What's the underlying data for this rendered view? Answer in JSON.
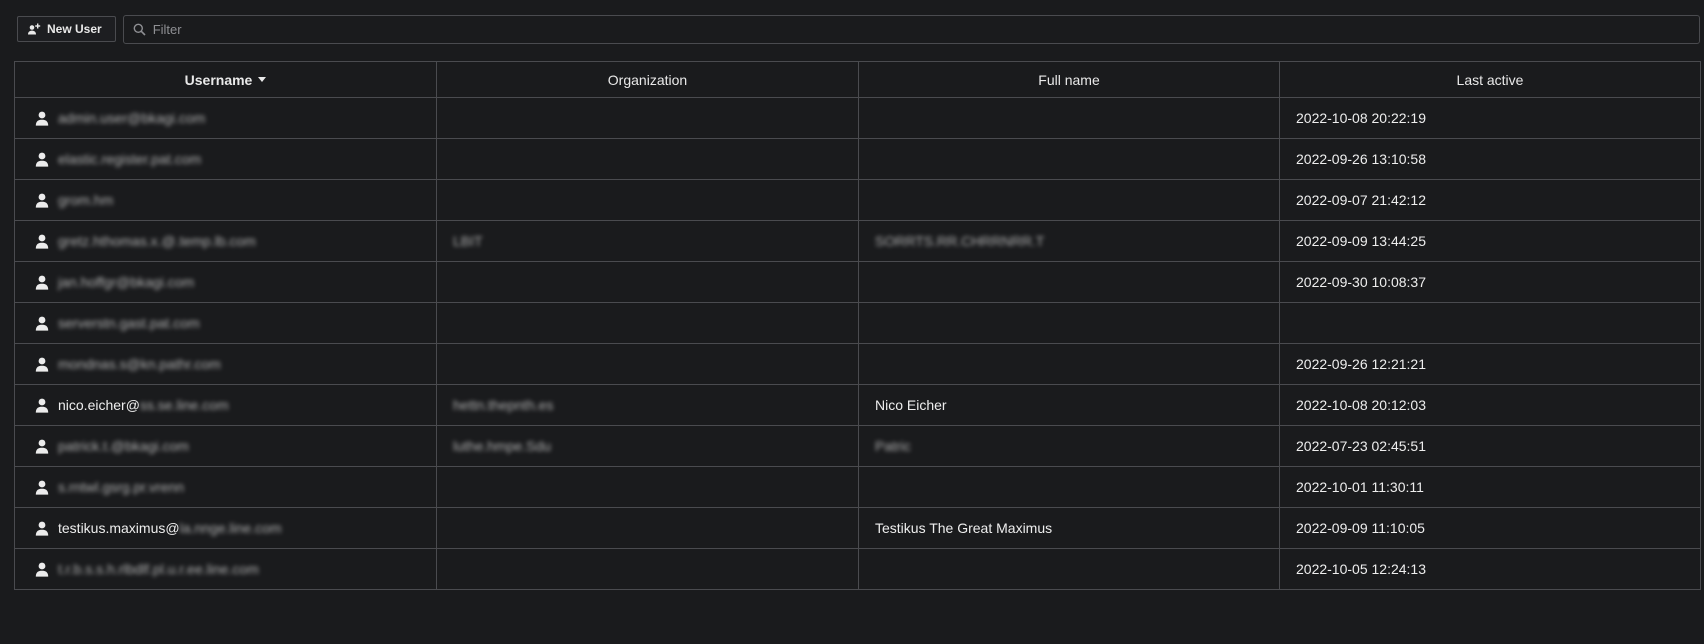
{
  "toolbar": {
    "new_user_label": "New User",
    "filter_placeholder": "Filter"
  },
  "table": {
    "columns": [
      "Username",
      "Organization",
      "Full name",
      "Last active"
    ],
    "sorted_column": "Username",
    "sort_direction": "descending",
    "rows": [
      {
        "username": "",
        "username_visible": "",
        "username_redacted": "admin.user@bkagi.com",
        "organization": "",
        "organization_redacted": "",
        "full_name": "",
        "full_name_redacted": "",
        "last_active": "2022-10-08 20:22:19"
      },
      {
        "username": "",
        "username_visible": "",
        "username_redacted": "elastic.register.pat.com",
        "organization": "",
        "organization_redacted": "",
        "full_name": "",
        "full_name_redacted": "",
        "last_active": "2022-09-26 13:10:58"
      },
      {
        "username": "",
        "username_visible": "",
        "username_redacted": "grom.hm",
        "organization": "",
        "organization_redacted": "",
        "full_name": "",
        "full_name_redacted": "",
        "last_active": "2022-09-07 21:42:12"
      },
      {
        "username": "",
        "username_visible": "",
        "username_redacted": "gretz.hthomas.x.@.temp.lb.com",
        "organization": "",
        "organization_redacted": "LBIT",
        "full_name": "",
        "full_name_redacted": "SORRTS.RR.CHRRNRR.T",
        "last_active": "2022-09-09 13:44:25"
      },
      {
        "username": "",
        "username_visible": "",
        "username_redacted": "jan.hoffgr@bkagi.com",
        "organization": "",
        "organization_redacted": "",
        "full_name": "",
        "full_name_redacted": "",
        "last_active": "2022-09-30 10:08:37"
      },
      {
        "username": "",
        "username_visible": "",
        "username_redacted": "serverstn.gast.pat.com",
        "organization": "",
        "organization_redacted": "",
        "full_name": "",
        "full_name_redacted": "",
        "last_active": ""
      },
      {
        "username": "",
        "username_visible": "",
        "username_redacted": "mondnas.s@kn.pathr.com",
        "organization": "",
        "organization_redacted": "",
        "full_name": "",
        "full_name_redacted": "",
        "last_active": "2022-09-26 12:21:21"
      },
      {
        "username": "nico.eicher@",
        "username_visible": "nico.eicher@",
        "username_redacted": "ss.se.line.com",
        "organization": "",
        "organization_redacted": "hettn.thepnth.es",
        "full_name": "Nico Eicher",
        "full_name_redacted": "",
        "last_active": "2022-10-08 20:12:03"
      },
      {
        "username": "",
        "username_visible": "",
        "username_redacted": "patrick.t.@bkagi.com",
        "organization": "",
        "organization_redacted": "luthe.hmpe.Sdu",
        "full_name": "",
        "full_name_redacted": "Patric",
        "last_active": "2022-07-23 02:45:51"
      },
      {
        "username": "",
        "username_visible": "",
        "username_redacted": "s.rntwl.gsrg.pr.vrenn",
        "organization": "",
        "organization_redacted": "",
        "full_name": "",
        "full_name_redacted": "",
        "last_active": "2022-10-01 11:30:11"
      },
      {
        "username": "testikus.maximus@",
        "username_visible": "testikus.maximus@",
        "username_redacted": "la.nnge.line.com",
        "organization": "",
        "organization_redacted": "",
        "full_name": "Testikus The Great Maximus",
        "full_name_redacted": "",
        "last_active": "2022-09-09 11:10:05"
      },
      {
        "username": "",
        "username_visible": "",
        "username_redacted": "t.r.b.s.s.h.rlbdlf.pl.u.r.ee.line.com",
        "organization": "",
        "organization_redacted": "",
        "full_name": "",
        "full_name_redacted": "",
        "last_active": "2022-10-05 12:24:13"
      }
    ]
  },
  "icons": {
    "new_user": "user-plus-icon",
    "filter": "search-icon",
    "row_user": "user-icon"
  },
  "colors": {
    "background": "#1a1b1d",
    "border": "#4a4b4f",
    "text": "#e9e9e9",
    "placeholder": "#8e8f93"
  }
}
